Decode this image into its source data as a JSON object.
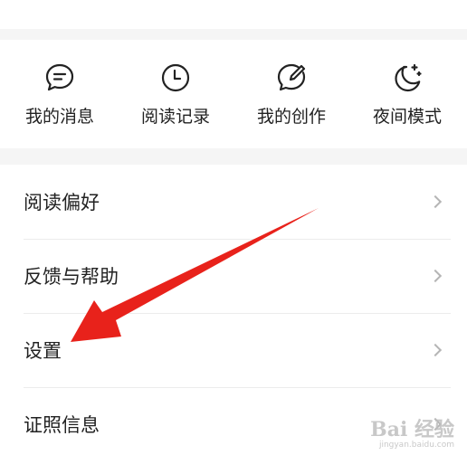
{
  "quick_actions": [
    {
      "label": "我的消息",
      "icon": "message-icon"
    },
    {
      "label": "阅读记录",
      "icon": "clock-icon"
    },
    {
      "label": "我的创作",
      "icon": "pen-bubble-icon"
    },
    {
      "label": "夜间模式",
      "icon": "moon-icon"
    }
  ],
  "menu": {
    "items": [
      {
        "label": "阅读偏好"
      },
      {
        "label": "反馈与帮助"
      },
      {
        "label": "设置"
      },
      {
        "label": "证照信息"
      }
    ]
  },
  "annotation": {
    "arrow_color": "#e8221b"
  },
  "watermark": {
    "main": "Bai 经验",
    "sub": "jingyan.baidu.com"
  },
  "colors": {
    "background": "#f5f5f5",
    "card": "#ffffff",
    "text": "#222222",
    "chevron": "#b5b5b5"
  }
}
